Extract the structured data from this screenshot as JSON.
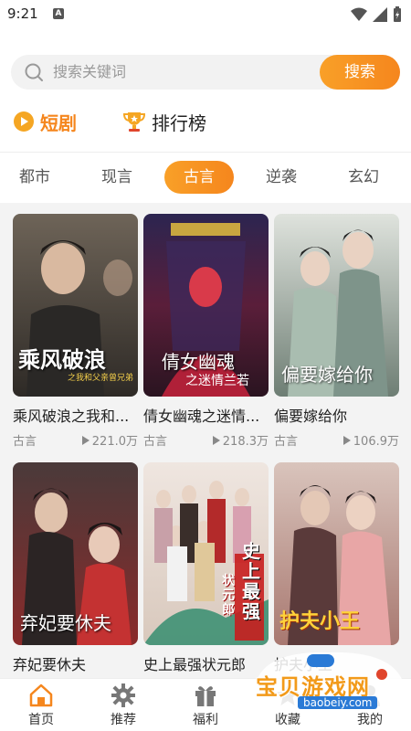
{
  "status": {
    "time": "9:21",
    "notif": "A"
  },
  "search": {
    "placeholder": "搜索关键词",
    "button": "搜索"
  },
  "header": {
    "short_drama": "短剧",
    "ranking": "排行榜"
  },
  "categories": [
    {
      "label": "都市",
      "active": false
    },
    {
      "label": "现言",
      "active": false
    },
    {
      "label": "古言",
      "active": true
    },
    {
      "label": "逆袭",
      "active": false
    },
    {
      "label": "玄幻",
      "active": false
    }
  ],
  "cards": [
    {
      "title": "乘风破浪之我和...",
      "tag": "古言",
      "plays": "221.0万",
      "poster_text": "乘风破浪",
      "poster_sub": "之我和父亲曾兄弟",
      "color": "#5a5045"
    },
    {
      "title": "倩女幽魂之迷情...",
      "tag": "古言",
      "plays": "218.3万",
      "poster_text": "倩女幽魂",
      "poster_sub": "之迷情兰若",
      "color": "#3b2b4a"
    },
    {
      "title": "偏要嫁给你",
      "tag": "古言",
      "plays": "106.9万",
      "poster_text": "偏要嫁给你",
      "poster_sub": "",
      "color": "#8a9a8e"
    },
    {
      "title": "弃妃要休夫",
      "tag": "",
      "plays": "",
      "poster_text": "弃妃要休夫",
      "poster_sub": "",
      "color": "#6a3b3b"
    },
    {
      "title": "史上最强状元郎",
      "tag": "",
      "plays": "",
      "poster_text": "史上最强",
      "poster_sub": "状元郎",
      "color": "#c9a7a0"
    },
    {
      "title": "护夫小王",
      "tag": "",
      "plays": "",
      "poster_text": "护夫小王",
      "poster_sub": "",
      "color": "#8a6a6a"
    }
  ],
  "tabs": [
    {
      "label": "首页",
      "icon": "home-icon",
      "active": true
    },
    {
      "label": "推荐",
      "icon": "gear-icon",
      "active": false
    },
    {
      "label": "福利",
      "icon": "gift-icon",
      "active": false
    },
    {
      "label": "收藏",
      "icon": "star-icon",
      "active": false
    },
    {
      "label": "我的",
      "icon": "user-icon",
      "active": false
    }
  ],
  "watermark": {
    "title": "宝贝游戏网",
    "url": "baobeiy.com"
  },
  "colors": {
    "accent": "#f5861d",
    "accent_light": "#f9a028"
  }
}
